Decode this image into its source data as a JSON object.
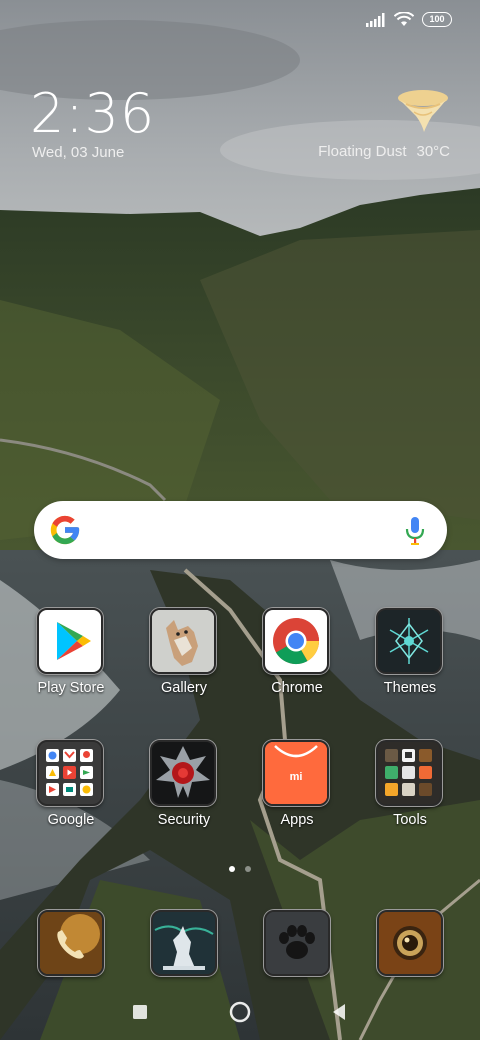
{
  "status_bar": {
    "battery_level": "100",
    "icons": [
      "signal-icon",
      "wifi-icon",
      "battery-icon"
    ]
  },
  "clock_widget": {
    "time": "2:36",
    "date": "Wed, 03 June",
    "weather_condition": "Floating Dust",
    "temperature": "30°C",
    "weather_icon": "floating-dust-icon"
  },
  "search": {
    "logo": "google-g-icon",
    "voice_icon": "mic-icon"
  },
  "apps": [
    {
      "label": "Play Store",
      "icon": "play-store-icon"
    },
    {
      "label": "Gallery",
      "icon": "gallery-icon"
    },
    {
      "label": "Chrome",
      "icon": "chrome-icon"
    },
    {
      "label": "Themes",
      "icon": "themes-icon"
    },
    {
      "label": "Google",
      "icon": "google-folder-icon"
    },
    {
      "label": "Security",
      "icon": "security-icon"
    },
    {
      "label": "Apps",
      "icon": "apps-icon"
    },
    {
      "label": "Tools",
      "icon": "tools-folder-icon"
    }
  ],
  "page_indicator": {
    "current": 1,
    "total": 2
  },
  "dock": [
    {
      "icon": "phone-icon"
    },
    {
      "icon": "wolf-icon"
    },
    {
      "icon": "paw-icon"
    },
    {
      "icon": "camera-icon"
    }
  ],
  "nav_bar": {
    "buttons": [
      "recents-button",
      "home-button",
      "back-button"
    ]
  },
  "colors": {
    "mi_orange": "#ff6a3d",
    "google_blue": "#4285f4",
    "google_red": "#ea4335",
    "google_yellow": "#fbbc05",
    "google_green": "#34a853"
  }
}
